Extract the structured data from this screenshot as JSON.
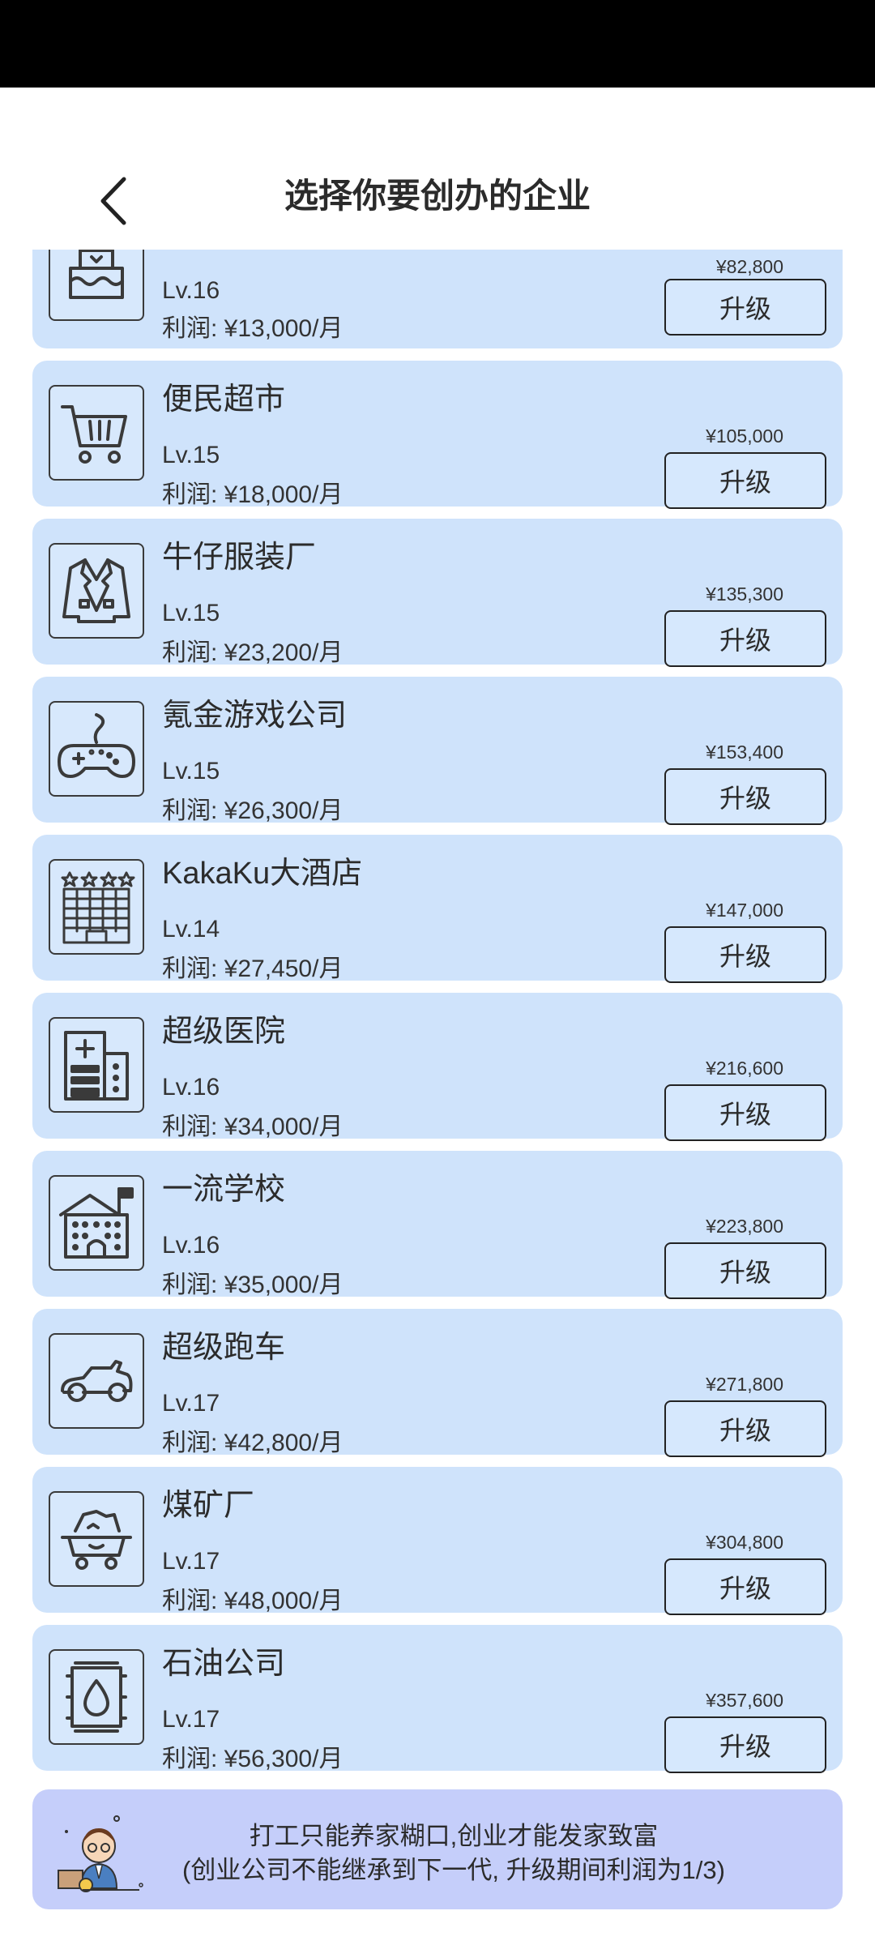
{
  "header": {
    "title": "选择你要创办的企业"
  },
  "upgrade_label": "升级",
  "companies": [
    {
      "name": "",
      "icon": "cake-icon",
      "level": "Lv.16",
      "profit": "利润: ¥13,000/月",
      "price": "¥82,800"
    },
    {
      "name": "便民超市",
      "icon": "shopping-cart-icon",
      "level": "Lv.15",
      "profit": "利润: ¥18,000/月",
      "price": "¥105,000"
    },
    {
      "name": "牛仔服装厂",
      "icon": "jacket-icon",
      "level": "Lv.15",
      "profit": "利润: ¥23,200/月",
      "price": "¥135,300"
    },
    {
      "name": "氪金游戏公司",
      "icon": "gamepad-icon",
      "level": "Lv.15",
      "profit": "利润: ¥26,300/月",
      "price": "¥153,400"
    },
    {
      "name": "KakaKu大酒店",
      "icon": "hotel-icon",
      "level": "Lv.14",
      "profit": "利润: ¥27,450/月",
      "price": "¥147,000"
    },
    {
      "name": "超级医院",
      "icon": "hospital-icon",
      "level": "Lv.16",
      "profit": "利润: ¥34,000/月",
      "price": "¥216,600"
    },
    {
      "name": "一流学校",
      "icon": "school-icon",
      "level": "Lv.16",
      "profit": "利润: ¥35,000/月",
      "price": "¥223,800"
    },
    {
      "name": "超级跑车",
      "icon": "sports-car-icon",
      "level": "Lv.17",
      "profit": "利润: ¥42,800/月",
      "price": "¥271,800"
    },
    {
      "name": "煤矿厂",
      "icon": "mine-cart-icon",
      "level": "Lv.17",
      "profit": "利润: ¥48,000/月",
      "price": "¥304,800"
    },
    {
      "name": "石油公司",
      "icon": "oil-barrel-icon",
      "level": "Lv.17",
      "profit": "利润: ¥56,300/月",
      "price": "¥357,600"
    }
  ],
  "banner": {
    "line1": "打工只能养家糊口,创业才能发家致富",
    "line2": "(创业公司不能继承到下一代, 升级期间利润为1/3)"
  }
}
